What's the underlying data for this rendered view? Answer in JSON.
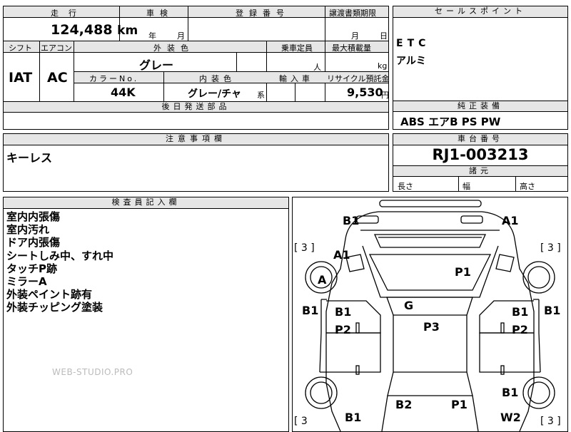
{
  "top": {
    "mileage_label": "走行",
    "inspection_label": "車検",
    "registration_label": "登録番号",
    "transfer_label": "譲渡書類期限",
    "sales_points_label": "セールスポイント",
    "mileage_value": "124,488",
    "mileage_unit": "km",
    "year_unit": "年",
    "month_unit": "月",
    "transfer_month": "月",
    "transfer_day": "日"
  },
  "spec": {
    "shift_label": "シフト",
    "aircon_label": "エアコン",
    "exterior_label": "外装色",
    "capacity_label": "乗車定員",
    "max_load_label": "最大積載量",
    "shift_value": "IAT",
    "aircon_value": "AC",
    "exterior_value": "グレー",
    "capacity_unit": "人",
    "load_unit": "kg",
    "color_no_label": "カラーNo.",
    "interior_label": "内装色",
    "import_label": "輸入車",
    "recycle_label": "リサイクル預託金",
    "color_no_value": "44K",
    "interior_value": "グレー/チャ",
    "interior_suffix": "系",
    "recycle_value": "9,530",
    "recycle_unit": "円"
  },
  "sales_points": [
    "ETC",
    "アルミ"
  ],
  "later_parts_label": "後日発送部品",
  "genuine_label": "純正装備",
  "genuine_value": "ABS エアB PS PW",
  "notes_label": "注意事項欄",
  "notes_value": "キーレス",
  "chassis_label": "車台番号",
  "chassis_value": "RJ1-003213",
  "dims": {
    "label": "諸元",
    "length": "長さ",
    "width": "幅",
    "height": "高さ"
  },
  "inspector_label": "検査員記入欄",
  "inspector_notes": [
    "室内内張傷",
    "室内汚れ",
    "ドア内張傷",
    "シートしみ中、すれ中",
    "タッチP跡",
    "ミラーA",
    "外装ペイント跡有",
    "外装チッピング塗装"
  ],
  "watermark": "WEB-STUDIO.PRO",
  "diagram": {
    "tire_left_top": "[ 3 ]",
    "tire_right_top": "[ 3 ]",
    "tire_left_bottom": "[ 3",
    "tire_right_bottom": "[ 3 ]",
    "marks": {
      "front_bumper_left": "B1",
      "front_bumper_right": "A1",
      "fender_left": "A1",
      "wheel_left": "A",
      "hood": "P1",
      "roof": "G",
      "front_door_left_b": "B1",
      "front_door_left_p": "P2",
      "front_door_right_b": "B1",
      "front_door_right_p": "P2",
      "side_left": "B1",
      "side_right": "B1",
      "center": "P3",
      "rear_fender_right": "B1",
      "trunk_left": "B2",
      "trunk_right": "P1",
      "rear_left": "B1",
      "rear_right": "W2"
    }
  }
}
